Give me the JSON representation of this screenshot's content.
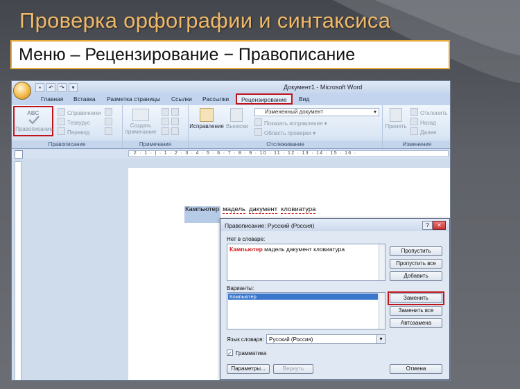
{
  "slide": {
    "title": "Проверка орфографии и синтаксиса",
    "subtitle": "Меню – Рецензирование − Правописание"
  },
  "word": {
    "window_title": "Документ1 - Microsoft Word",
    "tabs": [
      "Главная",
      "Вставка",
      "Разметка страницы",
      "Ссылки",
      "Рассылки",
      "Рецензирование",
      "Вид"
    ],
    "active_tab": "Рецензирование",
    "ribbon": {
      "spelling": {
        "abc": "ABC",
        "label": "Правописание",
        "group": "Правописание",
        "items": [
          "Справочники",
          "Тезаурус",
          "Перевод"
        ]
      },
      "comments": {
        "create": "Создать",
        "create2": "примечание",
        "group": "Примечания"
      },
      "tracking": {
        "track": "Исправления",
        "balloons": "Выноски",
        "display_for_review": "Измененный документ",
        "show_markup": "Показать исправления",
        "reviewing_pane": "Область проверки",
        "group": "Отслеживание"
      },
      "changes": {
        "accept": "Принять",
        "reject": "Отклонить",
        "previous": "Назад",
        "next": "Далее",
        "group": "Изменения"
      }
    },
    "ruler_text": "· 2 · 1 · | · 1 · 2 · 3 · 4 · 5 · 6 · 7 · 8 · 9 · 10 · 11 · 12 · 13 · 14 · 15 · 16 ·",
    "document_words": [
      "Кампьютер",
      "мадель",
      "дакумент",
      "кловиатура"
    ]
  },
  "dialog": {
    "title": "Правописание: Русский (Россия)",
    "not_in_dict_label": "Нет в словаре:",
    "error_word": "Кампьютер",
    "context_text": "мадель   дакумент  кловиатура",
    "suggestions_label": "Варианты:",
    "suggestions": [
      "Компьютер"
    ],
    "buttons": {
      "ignore": "Пропустить",
      "ignore_all": "Пропустить все",
      "add": "Добавить",
      "change": "Заменить",
      "change_all": "Заменить все",
      "autocorrect": "Автозамена",
      "options": "Параметры...",
      "undo": "Вернуть",
      "cancel": "Отмена"
    },
    "language_label": "Язык словаря:",
    "language_value": "Русский (Россия)",
    "grammar_label": "Грамматика",
    "grammar_checked": true
  },
  "colors": {
    "highlight": "#c0141b",
    "title_text": "#f0b96a",
    "subtitle_border": "#e8a93c"
  }
}
